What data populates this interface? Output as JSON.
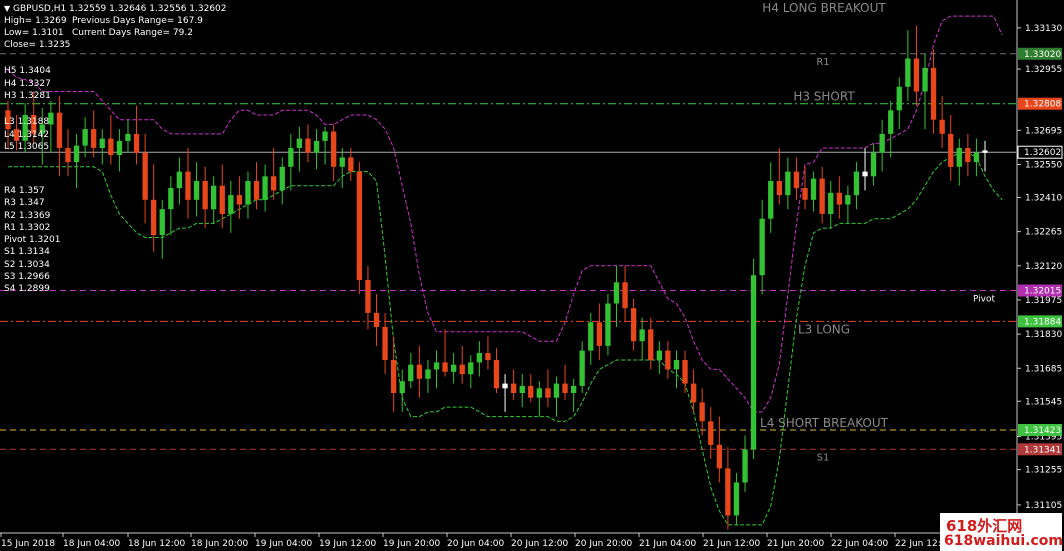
{
  "header": {
    "symbol_line": "GBPUSD,H1  1.32559 1.32646 1.32556 1.32602",
    "high": "High= 1.3269",
    "low": "Low= 1.3101",
    "close": "Close= 1.3235",
    "prev_range": "Previous Days Range= 167.9",
    "curr_range": "Current Days Range= 79.2"
  },
  "camarilla": [
    "H5 1.3404",
    "H4 1.3327",
    "H3 1.3281",
    "L3 1.3188",
    "L4 1.3142",
    "L5 1.3065"
  ],
  "pivots": [
    "R4 1.357",
    "R3 1.347",
    "R2 1.3369",
    "R1 1.3302",
    "Pivot 1.3201",
    "S1 1.3134",
    "S2 1.3034",
    "S3 1.2966",
    "S4 1.2899"
  ],
  "watermark": {
    "line1": "618外汇网",
    "line2": "618waihui.com"
  },
  "colors": {
    "bull": "#33c233",
    "bear": "#e8461b",
    "doji": "#ffffff",
    "envelope_upper": "#cc33cc",
    "envelope_lower": "#33cc33"
  },
  "chart_data": {
    "type": "candlestick",
    "symbol": "GBPUSD",
    "timeframe": "H1",
    "ylim": [
      1.3098,
      1.3322
    ],
    "y_ticks": [
      1.3313,
      1.32955,
      1.32695,
      1.3255,
      1.3241,
      1.32265,
      1.3212,
      1.31975,
      1.3183,
      1.31685,
      1.31545,
      1.31395,
      1.31255,
      1.31105
    ],
    "x_labels": [
      "15 Jun 2018",
      "18 Jun 04:00",
      "18 Jun 12:00",
      "18 Jun 20:00",
      "19 Jun 04:00",
      "19 Jun 12:00",
      "19 Jun 20:00",
      "20 Jun 04:00",
      "20 Jun 12:00",
      "20 Jun 20:00",
      "21 Jun 04:00",
      "21 Jun 12:00",
      "21 Jun 20:00",
      "22 Jun 04:00",
      "22 Jun 12:00"
    ],
    "level_lines": [
      {
        "name": "H4 LONG BREAKOUT",
        "value": 1.3335,
        "color": "#8a8a8a",
        "style": "none",
        "badge": ""
      },
      {
        "name": "R1",
        "value": 1.3302,
        "color": "#6f6f6f",
        "style": "dash",
        "badge": "1.33020",
        "badge_color": "#2f7d2f"
      },
      {
        "name": "H3 SHORT",
        "value": 1.32808,
        "color": "#40d040",
        "style": "dashdot",
        "badge": "1.32808",
        "badge_color": "#e8461b"
      },
      {
        "name": "",
        "value": 1.32602,
        "color": "#aaaaaa",
        "style": "solid",
        "badge": "1.32602",
        "badge_color": "#000000"
      },
      {
        "name": "Pivot",
        "value": 1.32015,
        "color": "#bb33bb",
        "style": "dash",
        "badge": "1.32015",
        "badge_color": "#b030b0"
      },
      {
        "name": "L3 LONG",
        "value": 1.31884,
        "color": "#e84a2a",
        "style": "dashdot",
        "badge": "1.31884",
        "badge_color": "#3fc23f"
      },
      {
        "name": "L4 SHORT BREAKOUT",
        "value": 1.31423,
        "color": "#d9b830",
        "style": "dash",
        "badge": "1.31423",
        "badge_color": "#3fc23f"
      },
      {
        "name": "S1",
        "value": 1.31341,
        "color": "#b03a3a",
        "style": "dash",
        "badge": "1.31341",
        "badge_color": "#b03a3a"
      }
    ],
    "candles": [
      [
        1.3278,
        1.3282,
        1.3262,
        1.327
      ],
      [
        1.327,
        1.3276,
        1.3261,
        1.3265
      ],
      [
        1.3265,
        1.3281,
        1.326,
        1.3276
      ],
      [
        1.3276,
        1.3286,
        1.3264,
        1.3268
      ],
      [
        1.3268,
        1.3279,
        1.3255,
        1.3272
      ],
      [
        1.3272,
        1.3282,
        1.326,
        1.3277
      ],
      [
        1.3277,
        1.3284,
        1.325,
        1.3262
      ],
      [
        1.3262,
        1.327,
        1.325,
        1.3256
      ],
      [
        1.3256,
        1.3268,
        1.3245,
        1.3263
      ],
      [
        1.3263,
        1.3275,
        1.3258,
        1.327
      ],
      [
        1.327,
        1.3278,
        1.3258,
        1.3262
      ],
      [
        1.3262,
        1.327,
        1.3255,
        1.3266
      ],
      [
        1.3266,
        1.3276,
        1.3255,
        1.3259
      ],
      [
        1.3259,
        1.327,
        1.3252,
        1.3265
      ],
      [
        1.3265,
        1.3274,
        1.326,
        1.3268
      ],
      [
        1.3268,
        1.328,
        1.3255,
        1.326
      ],
      [
        1.326,
        1.3268,
        1.323,
        1.324
      ],
      [
        1.324,
        1.3255,
        1.3218,
        1.3225
      ],
      [
        1.3225,
        1.324,
        1.3215,
        1.3236
      ],
      [
        1.3236,
        1.325,
        1.3225,
        1.3245
      ],
      [
        1.3245,
        1.3258,
        1.3238,
        1.3252
      ],
      [
        1.3252,
        1.3262,
        1.3232,
        1.324
      ],
      [
        1.324,
        1.3256,
        1.3233,
        1.3248
      ],
      [
        1.3248,
        1.3254,
        1.3228,
        1.3236
      ],
      [
        1.3236,
        1.325,
        1.323,
        1.3246
      ],
      [
        1.3246,
        1.3255,
        1.3228,
        1.3234
      ],
      [
        1.3234,
        1.3248,
        1.3226,
        1.3242
      ],
      [
        1.3242,
        1.325,
        1.3232,
        1.3238
      ],
      [
        1.3238,
        1.3252,
        1.3232,
        1.3248
      ],
      [
        1.3248,
        1.3256,
        1.3236,
        1.324
      ],
      [
        1.324,
        1.3255,
        1.3235,
        1.325
      ],
      [
        1.325,
        1.3262,
        1.324,
        1.3244
      ],
      [
        1.3244,
        1.3258,
        1.3238,
        1.3254
      ],
      [
        1.3254,
        1.3268,
        1.3244,
        1.3262
      ],
      [
        1.3262,
        1.3271,
        1.3252,
        1.3266
      ],
      [
        1.3266,
        1.3272,
        1.3256,
        1.326
      ],
      [
        1.326,
        1.327,
        1.3253,
        1.3265
      ],
      [
        1.3265,
        1.3271,
        1.3255,
        1.3269
      ],
      [
        1.3269,
        1.3272,
        1.3248,
        1.3254
      ],
      [
        1.3254,
        1.3262,
        1.3245,
        1.3258
      ],
      [
        1.3258,
        1.3262,
        1.3248,
        1.3252
      ],
      [
        1.3252,
        1.3256,
        1.32,
        1.3206
      ],
      [
        1.3206,
        1.3212,
        1.3185,
        1.3192
      ],
      [
        1.3192,
        1.32,
        1.3178,
        1.3186
      ],
      [
        1.3186,
        1.3192,
        1.3166,
        1.3172
      ],
      [
        1.3172,
        1.3182,
        1.315,
        1.3158
      ],
      [
        1.3158,
        1.3168,
        1.315,
        1.3163
      ],
      [
        1.3163,
        1.3175,
        1.316,
        1.317
      ],
      [
        1.317,
        1.3178,
        1.3156,
        1.3164
      ],
      [
        1.3164,
        1.3172,
        1.3158,
        1.3168
      ],
      [
        1.3168,
        1.3176,
        1.316,
        1.3171
      ],
      [
        1.3171,
        1.3185,
        1.3165,
        1.3167
      ],
      [
        1.3167,
        1.3175,
        1.3162,
        1.317
      ],
      [
        1.317,
        1.3178,
        1.3162,
        1.3166
      ],
      [
        1.3166,
        1.3174,
        1.316,
        1.3171
      ],
      [
        1.3171,
        1.318,
        1.3165,
        1.3175
      ],
      [
        1.3175,
        1.3182,
        1.3168,
        1.3172
      ],
      [
        1.3172,
        1.3177,
        1.3158,
        1.316
      ],
      [
        1.316,
        1.3166,
        1.315,
        1.3162
      ],
      [
        1.3162,
        1.3168,
        1.3155,
        1.3158
      ],
      [
        1.3158,
        1.3166,
        1.3152,
        1.3161
      ],
      [
        1.3161,
        1.3166,
        1.3154,
        1.3156
      ],
      [
        1.3156,
        1.3163,
        1.3148,
        1.316
      ],
      [
        1.316,
        1.3168,
        1.3152,
        1.3156
      ],
      [
        1.3156,
        1.3165,
        1.3148,
        1.3162
      ],
      [
        1.3162,
        1.317,
        1.3155,
        1.3158
      ],
      [
        1.3158,
        1.3164,
        1.315,
        1.3161
      ],
      [
        1.3161,
        1.318,
        1.3158,
        1.3176
      ],
      [
        1.3176,
        1.3192,
        1.317,
        1.3188
      ],
      [
        1.3188,
        1.3196,
        1.3172,
        1.3178
      ],
      [
        1.3178,
        1.32,
        1.3174,
        1.3196
      ],
      [
        1.3196,
        1.3212,
        1.3186,
        1.3205
      ],
      [
        1.3205,
        1.3212,
        1.3188,
        1.3194
      ],
      [
        1.3194,
        1.3198,
        1.3176,
        1.318
      ],
      [
        1.318,
        1.319,
        1.3172,
        1.3185
      ],
      [
        1.3185,
        1.319,
        1.3168,
        1.3172
      ],
      [
        1.3172,
        1.318,
        1.3166,
        1.3176
      ],
      [
        1.3176,
        1.318,
        1.3164,
        1.3168
      ],
      [
        1.3168,
        1.3176,
        1.316,
        1.3172
      ],
      [
        1.3172,
        1.3176,
        1.3158,
        1.3162
      ],
      [
        1.3162,
        1.3168,
        1.315,
        1.3154
      ],
      [
        1.3154,
        1.316,
        1.314,
        1.3146
      ],
      [
        1.3146,
        1.3152,
        1.313,
        1.3136
      ],
      [
        1.3136,
        1.3148,
        1.312,
        1.3126
      ],
      [
        1.3126,
        1.3135,
        1.31,
        1.3106
      ],
      [
        1.3106,
        1.3124,
        1.3102,
        1.312
      ],
      [
        1.312,
        1.314,
        1.3116,
        1.3134
      ],
      [
        1.3134,
        1.3215,
        1.313,
        1.3208
      ],
      [
        1.3208,
        1.324,
        1.32,
        1.3232
      ],
      [
        1.3232,
        1.3256,
        1.3226,
        1.3248
      ],
      [
        1.3248,
        1.3262,
        1.3238,
        1.3242
      ],
      [
        1.3242,
        1.3258,
        1.3236,
        1.3252
      ],
      [
        1.3252,
        1.3258,
        1.324,
        1.3245
      ],
      [
        1.3245,
        1.3254,
        1.3236,
        1.324
      ],
      [
        1.324,
        1.3252,
        1.3235,
        1.3249
      ],
      [
        1.3249,
        1.3254,
        1.323,
        1.3234
      ],
      [
        1.3234,
        1.3248,
        1.3228,
        1.3243
      ],
      [
        1.3243,
        1.325,
        1.3232,
        1.3238
      ],
      [
        1.3238,
        1.3246,
        1.323,
        1.3242
      ],
      [
        1.3242,
        1.3256,
        1.3236,
        1.3252
      ],
      [
        1.3252,
        1.3262,
        1.3244,
        1.325
      ],
      [
        1.325,
        1.3264,
        1.3246,
        1.326
      ],
      [
        1.326,
        1.3274,
        1.3252,
        1.3268
      ],
      [
        1.3268,
        1.3282,
        1.3258,
        1.3278
      ],
      [
        1.3278,
        1.3292,
        1.327,
        1.3288
      ],
      [
        1.3288,
        1.3312,
        1.3282,
        1.33
      ],
      [
        1.33,
        1.3314,
        1.328,
        1.3286
      ],
      [
        1.3286,
        1.3302,
        1.327,
        1.3296
      ],
      [
        1.3296,
        1.3304,
        1.3268,
        1.3274
      ],
      [
        1.3274,
        1.3284,
        1.3262,
        1.3268
      ],
      [
        1.3268,
        1.3276,
        1.3248,
        1.3254
      ],
      [
        1.3254,
        1.3266,
        1.3246,
        1.3262
      ],
      [
        1.3262,
        1.3268,
        1.325,
        1.3256
      ],
      [
        1.3256,
        1.3266,
        1.325,
        1.326
      ],
      [
        1.326,
        1.3265,
        1.3252,
        1.3261
      ]
    ],
    "envelope_upper": [
      1.3295,
      1.3292,
      1.3291,
      1.329,
      1.3286,
      1.3286,
      1.3286,
      1.3286,
      1.3286,
      1.3286,
      1.3286,
      1.3282,
      1.3278,
      1.3274,
      1.3274,
      1.3274,
      1.3274,
      1.3274,
      1.327,
      1.3268,
      1.3268,
      1.3268,
      1.3268,
      1.3268,
      1.3268,
      1.3268,
      1.3274,
      1.3278,
      1.3278,
      1.3276,
      1.3276,
      1.3276,
      1.3278,
      1.3278,
      1.3278,
      1.3278,
      1.3276,
      1.3272,
      1.3272,
      1.3274,
      1.3276,
      1.3276,
      1.3276,
      1.3274,
      1.327,
      1.3262,
      1.3246,
      1.323,
      1.3208,
      1.3192,
      1.3184,
      1.3184,
      1.3184,
      1.3184,
      1.3184,
      1.3184,
      1.3184,
      1.3184,
      1.3184,
      1.3184,
      1.3184,
      1.3182,
      1.318,
      1.318,
      1.318,
      1.3188,
      1.32,
      1.321,
      1.3212,
      1.3212,
      1.3212,
      1.3212,
      1.3212,
      1.3212,
      1.3212,
      1.3212,
      1.3205,
      1.3198,
      1.3196,
      1.319,
      1.318,
      1.3172,
      1.3168,
      1.3168,
      1.3164,
      1.316,
      1.3156,
      1.315,
      1.315,
      1.3156,
      1.317,
      1.32,
      1.323,
      1.3255,
      1.3256,
      1.3262,
      1.3262,
      1.3262,
      1.3262,
      1.3262,
      1.3262,
      1.3264,
      1.3264,
      1.3266,
      1.3268,
      1.327,
      1.3278,
      1.329,
      1.3306,
      1.3316,
      1.3318,
      1.3318,
      1.3318,
      1.3318,
      1.3318,
      1.3318,
      1.331
    ],
    "envelope_lower": [
      1.3254,
      1.3254,
      1.3254,
      1.3254,
      1.3254,
      1.3254,
      1.3254,
      1.3254,
      1.3254,
      1.3254,
      1.3254,
      1.3252,
      1.3242,
      1.3234,
      1.323,
      1.3226,
      1.3224,
      1.3224,
      1.3224,
      1.3226,
      1.3228,
      1.3228,
      1.323,
      1.323,
      1.323,
      1.3232,
      1.3234,
      1.3236,
      1.3238,
      1.324,
      1.324,
      1.3242,
      1.3244,
      1.3246,
      1.3246,
      1.3246,
      1.3246,
      1.3246,
      1.3246,
      1.325,
      1.3252,
      1.3252,
      1.3252,
      1.3248,
      1.3216,
      1.318,
      1.3156,
      1.3148,
      1.3148,
      1.315,
      1.315,
      1.3152,
      1.3152,
      1.3152,
      1.3152,
      1.315,
      1.3148,
      1.3148,
      1.3148,
      1.3148,
      1.3148,
      1.3148,
      1.3148,
      1.3148,
      1.3146,
      1.3146,
      1.3148,
      1.3154,
      1.3162,
      1.3168,
      1.317,
      1.3172,
      1.3172,
      1.3172,
      1.3172,
      1.3172,
      1.3172,
      1.3168,
      1.3166,
      1.3162,
      1.315,
      1.3134,
      1.3118,
      1.3108,
      1.3102,
      1.3102,
      1.3102,
      1.3102,
      1.3102,
      1.311,
      1.313,
      1.316,
      1.319,
      1.3212,
      1.3226,
      1.3228,
      1.3228,
      1.323,
      1.323,
      1.323,
      1.323,
      1.3232,
      1.3232,
      1.3232,
      1.3234,
      1.3236,
      1.324,
      1.3246,
      1.3252,
      1.3256,
      1.3258,
      1.326,
      1.326,
      1.3258,
      1.325,
      1.3244,
      1.324
    ]
  }
}
